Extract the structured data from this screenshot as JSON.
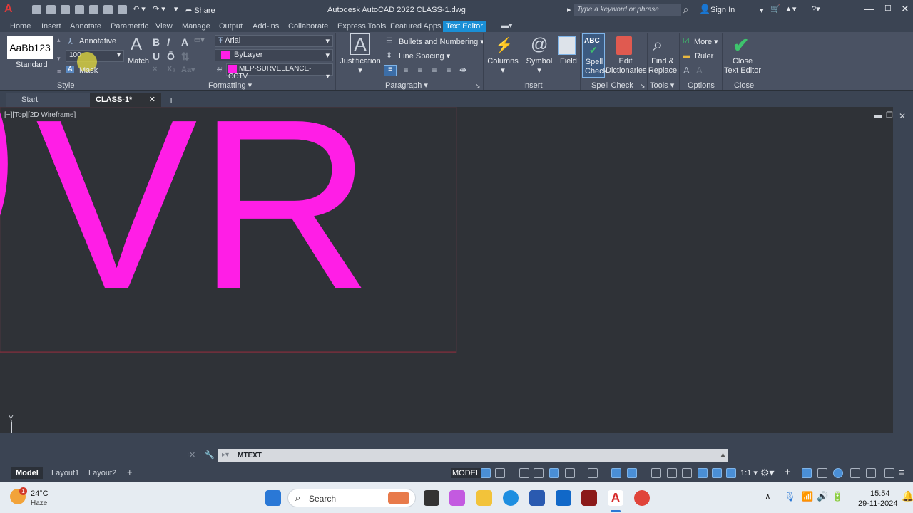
{
  "titlebar": {
    "app_logo": "A",
    "share_label": "Share",
    "title": "Autodesk AutoCAD 2022    CLASS-1.dwg",
    "search_placeholder": "Type a keyword or phrase",
    "sign_in": "Sign In"
  },
  "tabs": [
    "Home",
    "Insert",
    "Annotate",
    "Parametric",
    "View",
    "Manage",
    "Output",
    "Add-ins",
    "Collaborate",
    "Express Tools",
    "Featured Apps",
    "Text Editor"
  ],
  "ribbon": {
    "style": {
      "preview": "AaBb123",
      "style_name": "Standard",
      "annotative": "Annotative",
      "height_value": "100",
      "mask": "Mask",
      "panel": "Style"
    },
    "formatting": {
      "match": "Match",
      "bold": "B",
      "italic": "I",
      "strike": "A",
      "underline": "U",
      "overline": "Ō",
      "font": "Arial",
      "color": "ByLayer",
      "layer": "MEP-SURVELLANCE-CCTV",
      "panel": "Formatting"
    },
    "paragraph": {
      "justification": "Justification",
      "bullets": "Bullets and Numbering",
      "line_spacing": "Line Spacing",
      "panel": "Paragraph"
    },
    "insert": {
      "columns": "Columns",
      "symbol": "Symbol",
      "field": "Field",
      "panel": "Insert"
    },
    "spell": {
      "spell_check_1": "Spell",
      "spell_check_2": "Check",
      "edit_dict_1": "Edit",
      "edit_dict_2": "Dictionaries",
      "panel": "Spell Check"
    },
    "tools": {
      "find_1": "Find &",
      "find_2": "Replace",
      "panel": "Tools"
    },
    "options": {
      "more": "More",
      "ruler": "Ruler",
      "panel": "Options"
    },
    "close": {
      "close_1": "Close",
      "close_2": "Text Editor",
      "panel": "Close"
    }
  },
  "file_tabs": {
    "start": "Start",
    "current": "CLASS-1*"
  },
  "viewport_label": "[−][Top][2D Wireframe]",
  "drawing_text": "VR",
  "colors": {
    "text_magenta": "#ff1ee6",
    "accent": "#1a8fd6"
  },
  "command": {
    "text": "MTEXT"
  },
  "layout_tabs": [
    "Model",
    "Layout1",
    "Layout2"
  ],
  "status": {
    "model": "MODEL",
    "scale": "1:1"
  },
  "taskbar": {
    "temp": "24°C",
    "weather": "Haze",
    "search": "Search",
    "time": "15:54",
    "date": "29-11-2024"
  }
}
